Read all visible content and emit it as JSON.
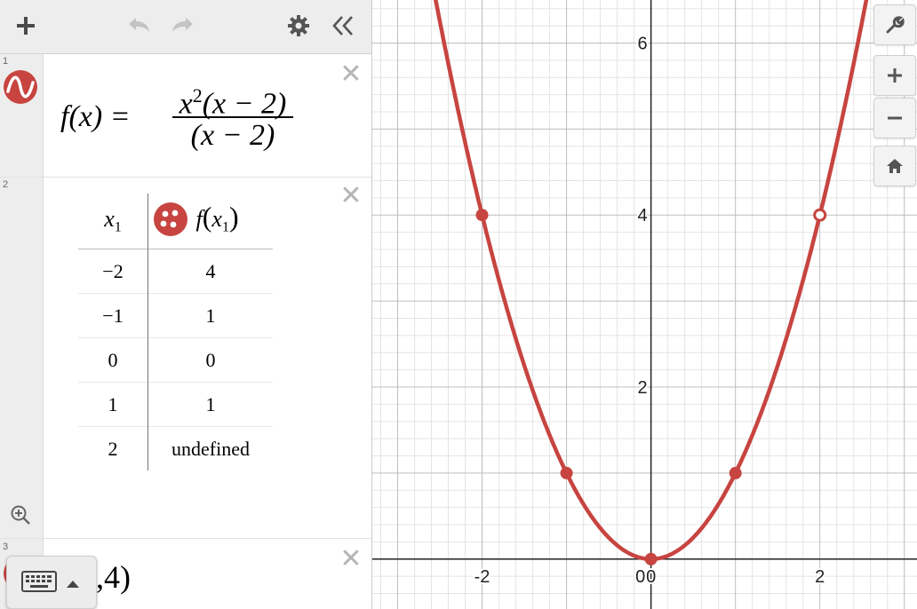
{
  "toolbar": {
    "add_icon": "plus-icon",
    "undo_icon": "undo-icon",
    "redo_icon": "redo-icon",
    "settings_icon": "gear-icon",
    "collapse_icon": "double-chevron-left-icon"
  },
  "expressions": [
    {
      "row_number": "1",
      "icon": "wave-icon",
      "color": "#c74440",
      "lhs": "f(x) =",
      "numerator_base": "x",
      "numerator_exp": "2",
      "numerator_rest": "(x − 2)",
      "denominator": "(x − 2)"
    },
    {
      "row_number": "2",
      "icon": "points-icon",
      "color": "#c74440",
      "table": {
        "headers": [
          {
            "var": "x",
            "sub": "1"
          },
          {
            "fn": "f",
            "var": "x",
            "sub": "1"
          }
        ],
        "rows": [
          [
            "−2",
            "4"
          ],
          [
            "−1",
            "1"
          ],
          [
            "0",
            "0"
          ],
          [
            "1",
            "1"
          ],
          [
            "2",
            "undefined"
          ]
        ]
      }
    },
    {
      "row_number": "3",
      "icon": "point-icon",
      "visible_text": ",4)"
    }
  ],
  "panel": {
    "zoom_icon": "zoom-fit-icon",
    "keyboard_icon": "keyboard-icon",
    "keyboard_arrow_icon": "caret-up-icon"
  },
  "graph_controls": {
    "settings_icon": "wrench-icon",
    "zoom_in_icon": "plus-icon",
    "zoom_out_icon": "minus-icon",
    "home_icon": "home-icon"
  },
  "chart_data": {
    "type": "line",
    "function": "f(x) = x^2 (x-2)/(x-2)",
    "curve_color": "#c74440",
    "xlim": [
      -3.3,
      3.15
    ],
    "ylim": [
      -0.58,
      6.5
    ],
    "x_ticks": [
      "-2",
      "0",
      "2"
    ],
    "y_ticks": [
      "2",
      "4",
      "6"
    ],
    "grid": true,
    "points": [
      {
        "x": -2,
        "y": 4,
        "style": "filled"
      },
      {
        "x": -1,
        "y": 1,
        "style": "filled"
      },
      {
        "x": 0,
        "y": 0,
        "style": "filled"
      },
      {
        "x": 1,
        "y": 1,
        "style": "filled"
      },
      {
        "x": 2,
        "y": 4,
        "style": "open"
      }
    ]
  }
}
